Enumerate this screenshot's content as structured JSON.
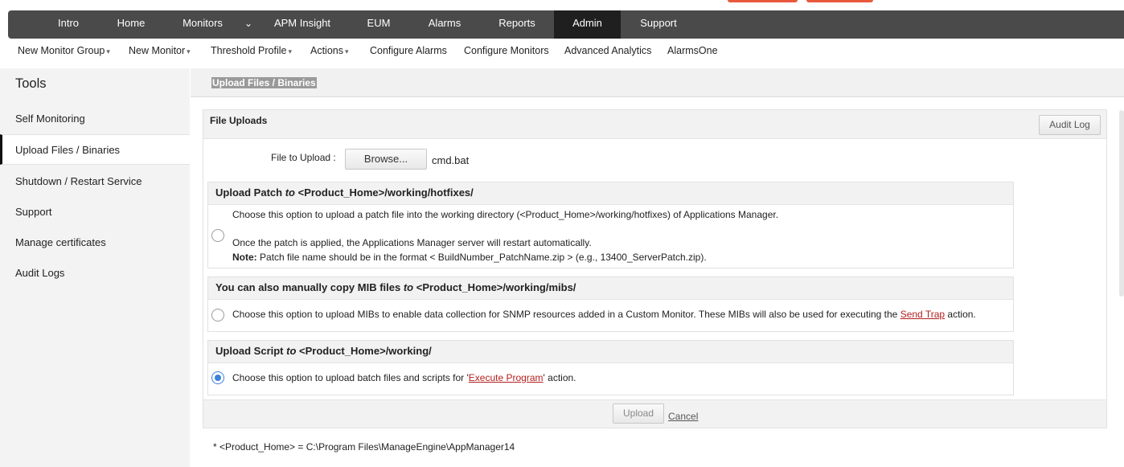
{
  "topnav": {
    "items": [
      "Intro",
      "Home",
      "Monitors",
      "APM Insight",
      "EUM",
      "Alarms",
      "Reports",
      "Admin",
      "Support"
    ],
    "active": "Admin"
  },
  "subnav": {
    "items": [
      "New Monitor Group",
      "New Monitor",
      "Threshold Profile",
      "Actions",
      "Configure Alarms",
      "Configure Monitors",
      "Advanced Analytics",
      "AlarmsOne"
    ]
  },
  "sidebar": {
    "title": "Tools",
    "items": [
      "Self Monitoring",
      "Upload Files / Binaries",
      "Shutdown / Restart Service",
      "Support",
      "Manage certificates",
      "Audit Logs"
    ],
    "active": "Upload Files / Binaries"
  },
  "page": {
    "title": "Upload Files / Binaries"
  },
  "panel": {
    "title": "File Uploads",
    "audit_log_label": "Audit Log",
    "file_label": "File to Upload :",
    "browse_label": "Browse...",
    "selected_file": "cmd.bat",
    "upload_label": "Upload",
    "cancel_label": "Cancel"
  },
  "options": {
    "patch": {
      "title_pre": "Upload Patch",
      "title_to": "to",
      "title_path": "<Product_Home>/working/hotfixes/",
      "line1": "Choose this option to upload a patch file into the working directory (<Product_Home>/working/hotfixes) of Applications Manager.",
      "line2": "Once the patch is applied, the Applications Manager server will restart automatically.",
      "note_label": "Note:",
      "note_text": "Patch file name should be in the format < BuildNumber_PatchName.zip > (e.g., 13400_ServerPatch.zip).",
      "selected": false
    },
    "mib": {
      "title_pre": "You can also manually copy MIB files",
      "title_to": "to",
      "title_path": "<Product_Home>/working/mibs/",
      "text_pre": "Choose this option to upload MIBs to enable data collection for SNMP resources added in a Custom Monitor. These MIBs will also be used for executing the",
      "link": "Send Trap",
      "text_post": "action.",
      "selected": false
    },
    "script": {
      "title_pre": "Upload Script",
      "title_to": "to",
      "title_path": "<Product_Home>/working/",
      "text_pre": "Choose this option to upload batch files and scripts for '",
      "link": "Execute Program",
      "text_post": "' action.",
      "selected": true
    }
  },
  "footnote": "*  <Product_Home> = C:\\Program Files\\ManageEngine\\AppManager14",
  "colors": {
    "nav_bg": "#4a4a4a",
    "nav_active": "#1f1f1f",
    "link": "#b41f1f",
    "radio_selected": "#3b82d8",
    "accent_orange": "#e8583d"
  }
}
